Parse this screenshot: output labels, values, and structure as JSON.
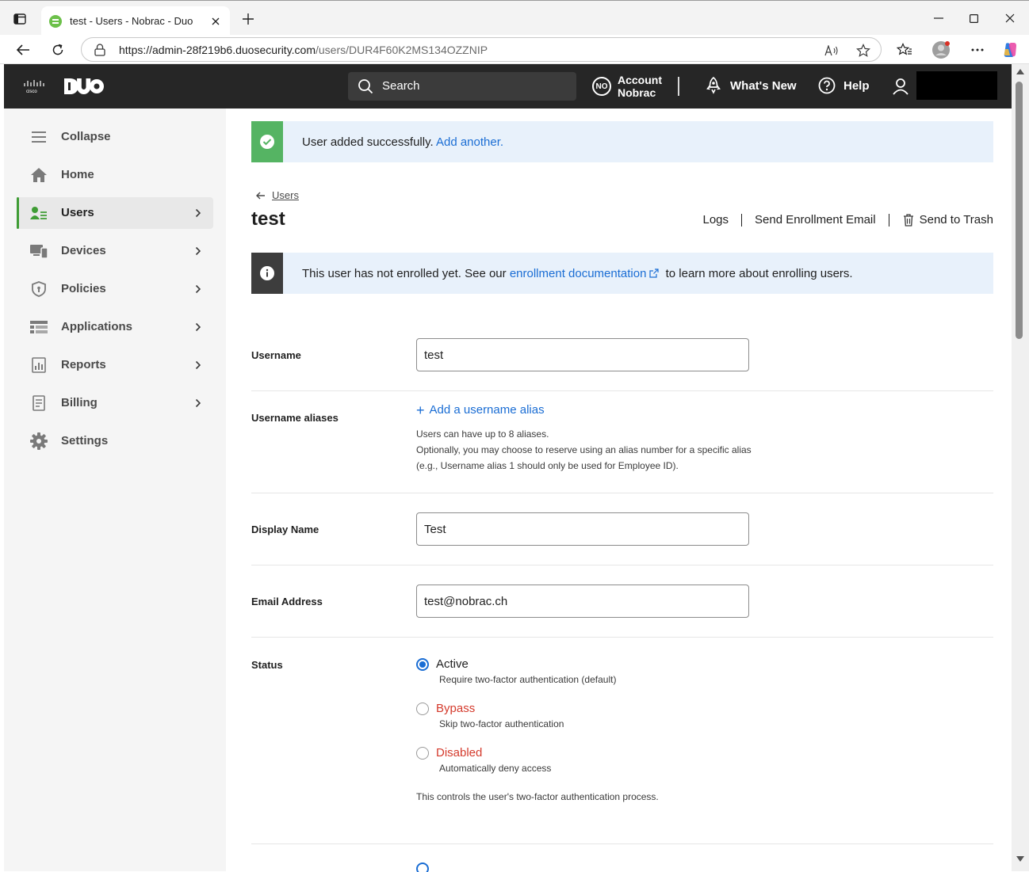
{
  "browser": {
    "tab_title": "test - Users - Nobrac - Duo",
    "url_host": "https://admin-28f219b6.duosecurity.com",
    "url_path": "/users/DUR4F60K2MS134OZZNIP"
  },
  "header": {
    "search_label": "Search",
    "account_initials": "NO",
    "account_line1": "Account",
    "account_line2": "Nobrac",
    "whats_new": "What's New",
    "help": "Help"
  },
  "sidebar": {
    "items": [
      {
        "label": "Collapse",
        "icon": "menu-icon"
      },
      {
        "label": "Home",
        "icon": "home-icon"
      },
      {
        "label": "Users",
        "icon": "users-icon",
        "active": true
      },
      {
        "label": "Devices",
        "icon": "devices-icon"
      },
      {
        "label": "Policies",
        "icon": "shield-icon"
      },
      {
        "label": "Applications",
        "icon": "applications-icon"
      },
      {
        "label": "Reports",
        "icon": "reports-icon"
      },
      {
        "label": "Billing",
        "icon": "billing-icon"
      },
      {
        "label": "Settings",
        "icon": "gear-icon"
      }
    ]
  },
  "success_alert": {
    "text": "User added successfully.",
    "link": "Add another."
  },
  "breadcrumb": "Users",
  "page_title": "test",
  "actions": {
    "logs": "Logs",
    "send_enrollment": "Send Enrollment Email",
    "trash": "Send to Trash"
  },
  "info_alert": {
    "before": "This user has not enrolled yet. See our",
    "link": "enrollment documentation",
    "after": "to learn more about enrolling users."
  },
  "form": {
    "username_label": "Username",
    "username_value": "test",
    "aliases_label": "Username aliases",
    "add_alias": "Add a username alias",
    "alias_help1": "Users can have up to 8 aliases.",
    "alias_help2": "Optionally, you may choose to reserve using an alias number for a specific alias",
    "alias_help3": "(e.g., Username alias 1 should only be used for Employee ID).",
    "display_name_label": "Display Name",
    "display_name_value": "Test",
    "email_label": "Email Address",
    "email_value": "test@nobrac.ch",
    "status_label": "Status",
    "status_options": [
      {
        "label": "Active",
        "desc": "Require two-factor authentication (default)",
        "selected": true
      },
      {
        "label": "Bypass",
        "desc": "Skip two-factor authentication",
        "selected": false
      },
      {
        "label": "Disabled",
        "desc": "Automatically deny access",
        "selected": false
      }
    ],
    "status_note": "This controls the user's two-factor authentication process."
  },
  "colors": {
    "header_bg": "#262626",
    "accent_green": "#3f9c35",
    "link_blue": "#1a6dd4",
    "warn_red": "#d43a2c"
  }
}
